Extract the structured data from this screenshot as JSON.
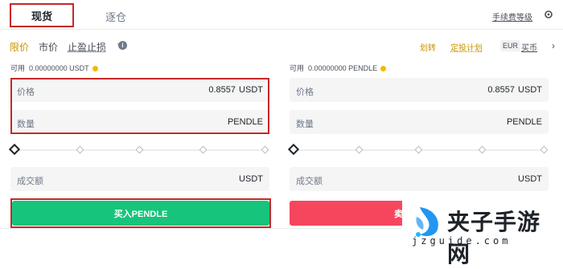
{
  "tabs": {
    "spot": "现货",
    "margin": "逐仓"
  },
  "header": {
    "fee_link": "手续费等级"
  },
  "order_types": {
    "limit": "限价",
    "market": "市价",
    "stop": "止盈止损"
  },
  "actions": {
    "transfer": "划转",
    "plan": "定投计划",
    "currency": "EUR",
    "buy_coin": "买币"
  },
  "buy": {
    "available_label": "可用",
    "available_value": "0.00000000 USDT",
    "price_label": "价格",
    "price_value": "0.8557",
    "price_unit": "USDT",
    "amount_label": "数量",
    "amount_unit": "PENDLE",
    "total_label": "成交额",
    "total_unit": "USDT",
    "button": "买入PENDLE",
    "slider_percent": 0
  },
  "sell": {
    "available_label": "可用",
    "available_value": "0.00000000 PENDLE",
    "price_label": "价格",
    "price_value": "0.8557",
    "price_unit": "USDT",
    "amount_label": "数量",
    "amount_unit": "PENDLE",
    "total_label": "成交额",
    "total_unit": "USDT",
    "button": "卖",
    "slider_percent": 0
  },
  "watermark": {
    "title": "夹子手游网",
    "url": "jzguide.com"
  },
  "colors": {
    "accent": "#c99400",
    "buy": "#17c47b",
    "sell": "#f6465d",
    "highlight": "#c62828"
  }
}
